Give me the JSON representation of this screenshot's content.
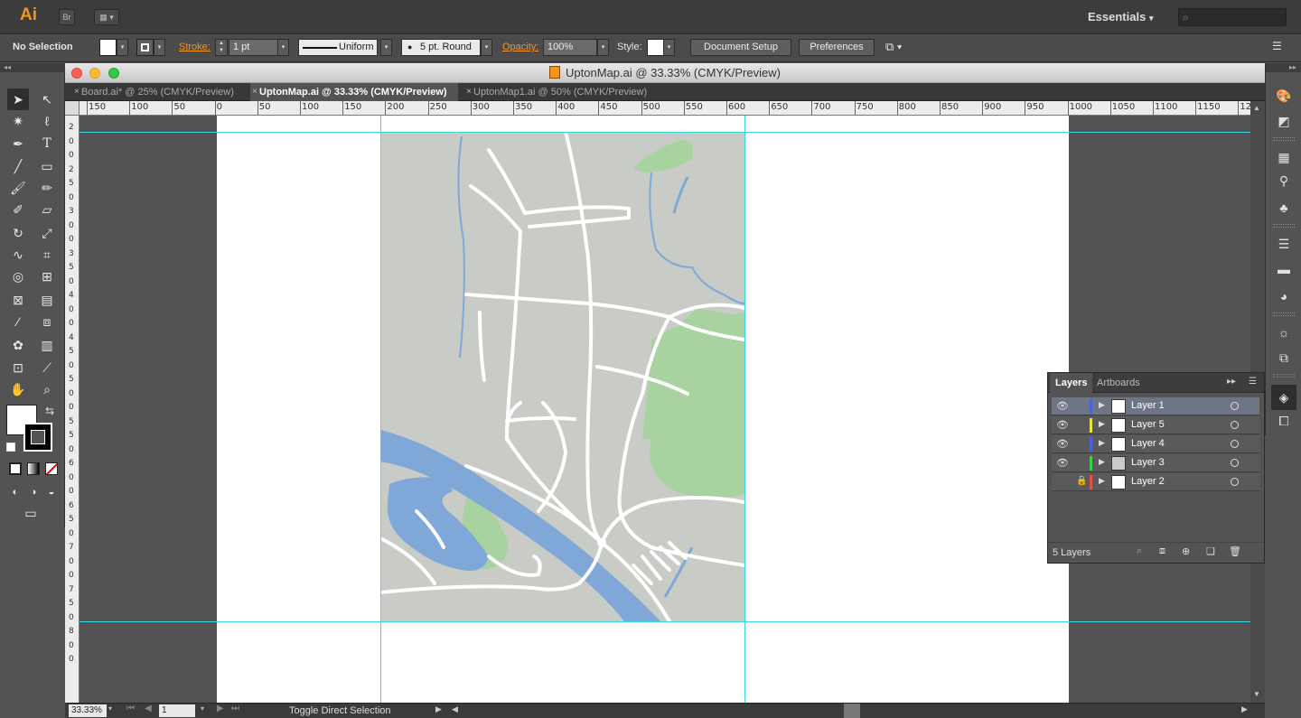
{
  "app": {
    "logo": "Ai",
    "bridge_button": "Br",
    "workspace": "Essentials"
  },
  "control_bar": {
    "selection_status": "No Selection",
    "stroke_label": "Stroke:",
    "stroke_weight": "1 pt",
    "stroke_profile": "Uniform",
    "brush": "5 pt. Round",
    "opacity_label": "Opacity:",
    "opacity_value": "100%",
    "style_label": "Style:",
    "document_setup": "Document Setup",
    "preferences": "Preferences"
  },
  "document": {
    "title": "UptonMap.ai @ 33.33% (CMYK/Preview)",
    "tabs": [
      {
        "label": "Board.ai* @ 25% (CMYK/Preview)",
        "active": false
      },
      {
        "label": "UptonMap.ai @ 33.33% (CMYK/Preview)",
        "active": true
      },
      {
        "label": "UptonMap1.ai @ 50% (CMYK/Preview)",
        "active": false
      }
    ],
    "ruler_h": [
      "150",
      "100",
      "50",
      "0",
      "50",
      "100",
      "150",
      "200",
      "250",
      "300",
      "350",
      "400",
      "450",
      "500",
      "550",
      "600",
      "650",
      "700",
      "750",
      "800",
      "850",
      "900",
      "950",
      "1000",
      "1050",
      "1100",
      "1150",
      "12"
    ],
    "ruler_v": [
      "2",
      "0",
      "0",
      "2",
      "5",
      "0",
      "3",
      "0",
      "0",
      "3",
      "5",
      "0",
      "4",
      "0",
      "0",
      "4",
      "5",
      "0",
      "5",
      "0",
      "0",
      "5",
      "5",
      "0",
      "6",
      "0",
      "0",
      "6",
      "5",
      "0",
      "7",
      "0",
      "0",
      "7",
      "5",
      "0",
      "8",
      "0",
      "0"
    ]
  },
  "status_bar": {
    "zoom": "33.33%",
    "artboard_number": "1",
    "status_text": "Toggle Direct Selection"
  },
  "layers_panel": {
    "tabs": [
      "Layers",
      "Artboards"
    ],
    "layers": [
      {
        "name": "Layer 1",
        "color": "#4f5fe0",
        "visible": true,
        "locked": false,
        "selected": true
      },
      {
        "name": "Layer 5",
        "color": "#e6e63c",
        "visible": true,
        "locked": false,
        "selected": false
      },
      {
        "name": "Layer 4",
        "color": "#4f5fe0",
        "visible": true,
        "locked": false,
        "selected": false
      },
      {
        "name": "Layer 3",
        "color": "#3ccf4a",
        "visible": true,
        "locked": false,
        "selected": false
      },
      {
        "name": "Layer 2",
        "color": "#e05050",
        "visible": false,
        "locked": true,
        "selected": false
      }
    ],
    "count": "5 Layers"
  },
  "colors": {
    "map_land": "#c9cbc6",
    "map_water": "#7fa8d8",
    "map_park": "#a8d3a0",
    "guide": "#3cd8e0",
    "accent": "#f7931e"
  }
}
